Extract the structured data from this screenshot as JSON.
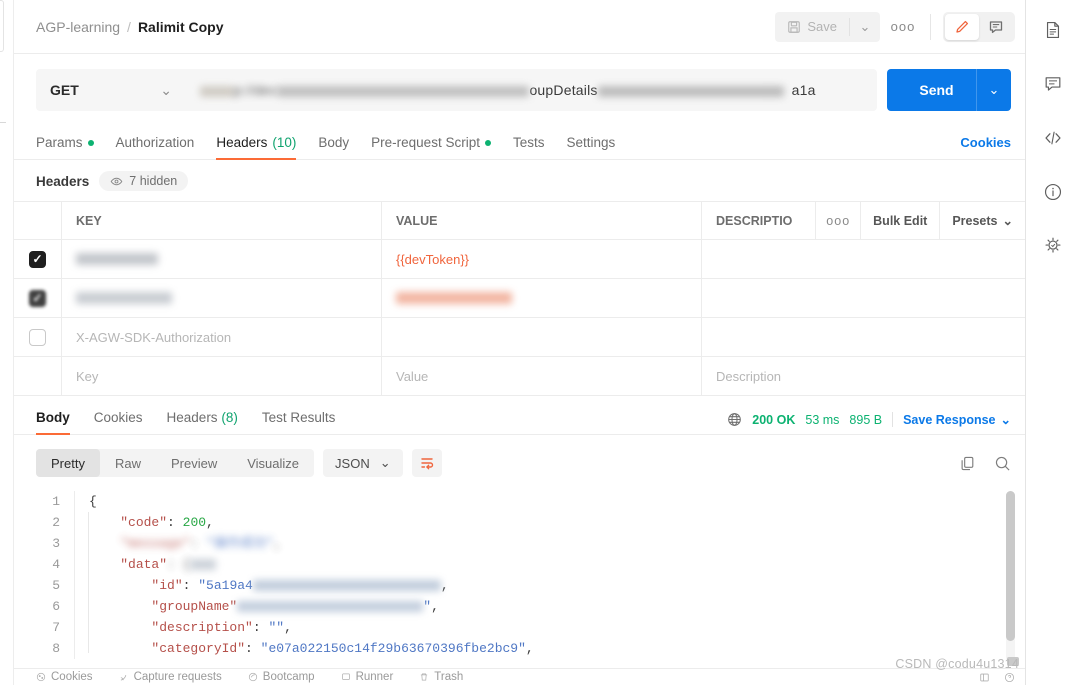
{
  "header": {
    "breadcrumb_parent": "AGP-learning",
    "breadcrumb_sep": "/",
    "breadcrumb_current": "Ralimit Copy",
    "save_label": "Save",
    "save_caret": "⌄",
    "more_label": "ooo"
  },
  "request": {
    "method": "GET",
    "method_caret": "⌄",
    "url_visible_1": "p://dev",
    "url_visible_2": "oupDetails",
    "url_visible_3": "a1a",
    "send_label": "Send",
    "send_caret": "⌄"
  },
  "request_tabs": [
    {
      "label": "Params",
      "dot": true,
      "count": "",
      "active": false
    },
    {
      "label": "Authorization",
      "dot": false,
      "count": "",
      "active": false
    },
    {
      "label": "Headers",
      "dot": false,
      "count": "(10)",
      "active": true
    },
    {
      "label": "Body",
      "dot": false,
      "count": "",
      "active": false
    },
    {
      "label": "Pre-request Script",
      "dot": true,
      "count": "",
      "active": false
    },
    {
      "label": "Tests",
      "dot": false,
      "count": "",
      "active": false
    },
    {
      "label": "Settings",
      "dot": false,
      "count": "",
      "active": false
    }
  ],
  "cookies_link": "Cookies",
  "headers_section": {
    "title": "Headers",
    "hidden_label": "7 hidden"
  },
  "headers_table": {
    "columns": {
      "key": "KEY",
      "value": "VALUE",
      "description": "DESCRIPTIO"
    },
    "tools": {
      "dots": "ooo",
      "bulk_edit": "Bulk Edit",
      "presets": "Presets",
      "presets_caret": "⌄"
    },
    "rows": [
      {
        "checked": true,
        "key": "",
        "key_redacted": true,
        "value": "{{devToken}}",
        "value_redacted": false,
        "value_is_variable": true,
        "description": ""
      },
      {
        "checked": true,
        "key": "",
        "key_redacted": true,
        "value": "",
        "value_redacted": true,
        "value_is_variable": true,
        "description": ""
      },
      {
        "checked": false,
        "key": "X-AGW-SDK-Authorization",
        "key_redacted": false,
        "value": "",
        "value_redacted": false,
        "value_is_variable": false,
        "description": ""
      }
    ],
    "placeholder_row": {
      "key": "Key",
      "value": "Value",
      "description": "Description"
    }
  },
  "response_tabs": [
    {
      "label": "Body",
      "count": "",
      "active": true
    },
    {
      "label": "Cookies",
      "count": "",
      "active": false
    },
    {
      "label": "Headers",
      "count": "(8)",
      "active": false
    },
    {
      "label": "Test Results",
      "count": "",
      "active": false
    }
  ],
  "response_status": {
    "status": "200 OK",
    "time": "53 ms",
    "size": "895 B",
    "save_response": "Save Response",
    "save_response_caret": "⌄"
  },
  "viewer": {
    "modes": [
      "Pretty",
      "Raw",
      "Preview",
      "Visualize"
    ],
    "active_mode": "Pretty",
    "format": "JSON",
    "format_caret": "⌄"
  },
  "response_body": {
    "lines": [
      {
        "n": "1",
        "indent": 0,
        "segments": [
          {
            "t": "{",
            "c": "p"
          }
        ]
      },
      {
        "n": "2",
        "indent": 1,
        "segments": [
          {
            "t": "\"code\"",
            "c": "k"
          },
          {
            "t": ": ",
            "c": "p"
          },
          {
            "t": "200",
            "c": "n"
          },
          {
            "t": ",",
            "c": "p"
          }
        ]
      },
      {
        "n": "3",
        "indent": 1,
        "redacted": true,
        "segments": [
          {
            "t": "\"message\"",
            "c": "k"
          },
          {
            "t": ": ",
            "c": "p"
          },
          {
            "t": "\"操作成功\"",
            "c": "s"
          },
          {
            "t": ",",
            "c": "p"
          }
        ]
      },
      {
        "n": "4",
        "indent": 1,
        "redacted_tail": true,
        "segments": [
          {
            "t": "\"data\"",
            "c": "k"
          },
          {
            "t": ": {",
            "c": "p"
          }
        ]
      },
      {
        "n": "5",
        "indent": 2,
        "redacted_tail": true,
        "segments": [
          {
            "t": "\"id\"",
            "c": "k"
          },
          {
            "t": ": ",
            "c": "p"
          },
          {
            "t": "\"5a19a4",
            "c": "s"
          }
        ]
      },
      {
        "n": "6",
        "indent": 2,
        "redacted_tail": true,
        "segments": [
          {
            "t": "\"groupName\"",
            "c": "k"
          },
          {
            "t": ": ",
            "c": "p"
          }
        ]
      },
      {
        "n": "7",
        "indent": 2,
        "segments": [
          {
            "t": "\"description\"",
            "c": "k"
          },
          {
            "t": ": ",
            "c": "p"
          },
          {
            "t": "\"\"",
            "c": "s"
          },
          {
            "t": ",",
            "c": "p"
          }
        ]
      },
      {
        "n": "8",
        "indent": 2,
        "segments": [
          {
            "t": "\"categoryId\"",
            "c": "k"
          },
          {
            "t": ": ",
            "c": "p"
          },
          {
            "t": "\"e07a022150c14f29b63670396fbe2bc9\"",
            "c": "s"
          },
          {
            "t": ",",
            "c": "p"
          }
        ]
      }
    ]
  },
  "statusbar": {
    "items": [
      "Cookies",
      "Capture requests",
      "Bootcamp",
      "Runner",
      "Trash"
    ]
  },
  "watermark": "CSDN @codu4u1314",
  "colors": {
    "accent_orange": "#fb6b36",
    "send_blue": "#0b79e8",
    "link_blue": "#0b79e8",
    "success_green": "#0cb271",
    "variable_orange": "#f0653d"
  }
}
